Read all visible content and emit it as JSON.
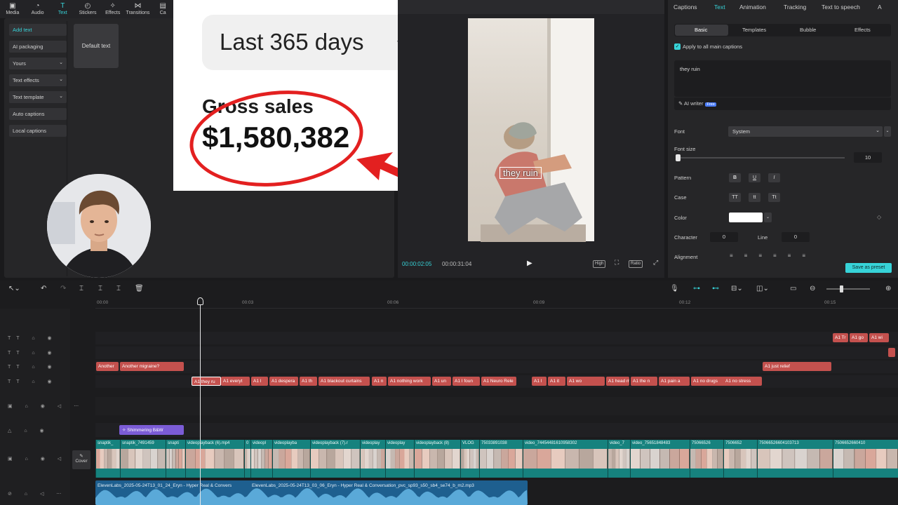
{
  "toolbar": {
    "items": [
      {
        "label": "Media",
        "icon": "media-icon"
      },
      {
        "label": "Audio",
        "icon": "audio-icon"
      },
      {
        "label": "Text",
        "icon": "text-icon"
      },
      {
        "label": "Stickers",
        "icon": "stickers-icon"
      },
      {
        "label": "Effects",
        "icon": "effects-icon"
      },
      {
        "label": "Transitions",
        "icon": "transitions-icon"
      },
      {
        "label": "Ca",
        "icon": "captions-icon"
      }
    ]
  },
  "left_panel": {
    "nav": [
      {
        "label": "Add text",
        "active": true
      },
      {
        "label": "AI packaging"
      },
      {
        "label": "Yours"
      },
      {
        "label": "Text effects"
      },
      {
        "label": "Text template"
      },
      {
        "label": "Auto captions"
      },
      {
        "label": "Local captions"
      }
    ],
    "default_text": "Default text"
  },
  "overlay": {
    "range_label": "Last 365 days",
    "gross_label": "Gross sales",
    "gross_value": "$1,580,382"
  },
  "preview": {
    "caption": "they ruin",
    "time_current": "00:00:02:05",
    "time_total": "00:00:31:04",
    "btn_high": "High",
    "btn_ratio": "Ratio"
  },
  "right_panel": {
    "tabs": [
      "Captions",
      "Text",
      "Animation",
      "Tracking",
      "Text to speech",
      "A"
    ],
    "subtabs": [
      "Basic",
      "Templates",
      "Bubble",
      "Effects"
    ],
    "apply_label": "Apply to all main captions",
    "text_value": "they ruin",
    "ai_writer": "AI writer",
    "ai_free": "Free",
    "font_label": "Font",
    "font_value": "System",
    "font_size_label": "Font size",
    "font_size_value": "10",
    "pattern_label": "Pattern",
    "pattern_btns": [
      "B",
      "U",
      "I"
    ],
    "case_label": "Case",
    "case_btns": [
      "TT",
      "tt",
      "Tt"
    ],
    "color_label": "Color",
    "text_color": "#ffffff",
    "character_label": "Character",
    "character_value": "0",
    "line_label": "Line",
    "line_value": "0",
    "alignment_label": "Alignment",
    "save_preset": "Save as preset"
  },
  "timeline": {
    "ticks": [
      "00:00",
      "00:03",
      "00:06",
      "00:09",
      "00:12",
      "00:15"
    ],
    "cover_label": "Cover",
    "text_track_1": [
      "A1 Tr",
      "A1 go",
      "A1 wi"
    ],
    "text_track_3": [
      {
        "label": "Another"
      },
      {
        "label": "Another migraine?"
      },
      {
        "label": "A1 just relief"
      }
    ],
    "caption_clips": [
      "A1 they ru",
      "A1 everyt",
      "A1 I",
      "A1 despera",
      "A1 th",
      "A1 blackout curtains",
      "A1 n",
      "A1 nothing work",
      "A1 un",
      "A1 I foun",
      "A1 Neuro Rele",
      "A1 l",
      "A1 it",
      "A1 wo",
      "A1 head ma",
      "A1 the n",
      "A1 pain a",
      "A1 in minut",
      "A1 no drugs",
      "A1 no stress"
    ],
    "fx_clip": "Shimmering B&W",
    "video_clips": [
      "snaptik_",
      "snaptik_7491459",
      "snapti",
      "videoplayback (6).mp4",
      "0",
      "videopl",
      "videoplayba",
      "videoplayback (7).r",
      "videoplay",
      "videoplay",
      "videoplayback (8)",
      "VLOG",
      "75033891038",
      "video_74454481610958302",
      "video_7",
      "video_75651848483",
      "75066526",
      "7506652",
      "75066526604103713",
      "7506652660410"
    ],
    "audio_clips": [
      "ElevenLabs_2025-05-24T13_01_24_Eryn - Hyper Real & Convers",
      "ElevenLabs_2025-05-24T13_03_06_Eryn - Hyper Real & Conversation_pvc_sp93_s50_sb4_se74_b_m2.mp3"
    ]
  },
  "colors": {
    "accent": "#37d3d8",
    "caption_clip": "#c4514e",
    "video_track": "#16827e",
    "audio_track": "#1e5f8f",
    "fx_clip": "#7b5cd6",
    "highlight": "#e32020"
  }
}
